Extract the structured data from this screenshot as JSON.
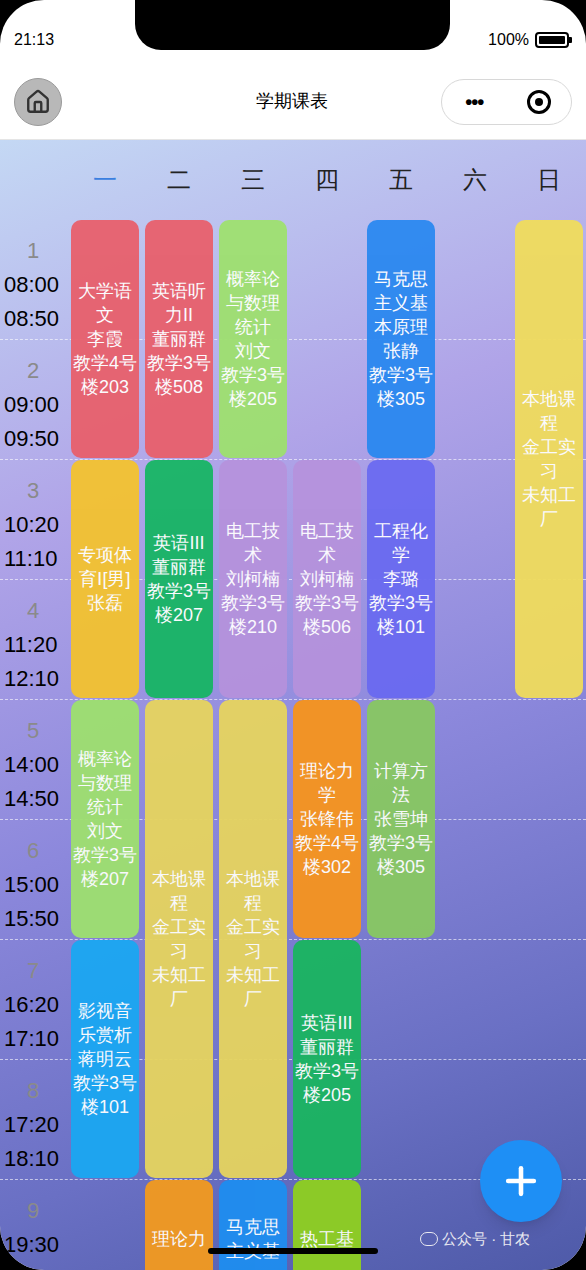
{
  "status_bar": {
    "time": "21:13",
    "battery": "100%",
    "battery_level": 1
  },
  "nav": {
    "title": "学期课表",
    "menu": "•••"
  },
  "weekdays": [
    {
      "label": "一",
      "selected": true
    },
    {
      "label": "二",
      "selected": false
    },
    {
      "label": "三",
      "selected": false
    },
    {
      "label": "四",
      "selected": false
    },
    {
      "label": "五",
      "selected": false
    },
    {
      "label": "六",
      "selected": false
    },
    {
      "label": "日",
      "selected": false
    }
  ],
  "periods": [
    {
      "number": "1",
      "start": "08:00",
      "end": "08:50"
    },
    {
      "number": "2",
      "start": "09:00",
      "end": "09:50"
    },
    {
      "number": "3",
      "start": "10:20",
      "end": "11:10"
    },
    {
      "number": "4",
      "start": "11:20",
      "end": "12:10"
    },
    {
      "number": "5",
      "start": "14:00",
      "end": "14:50"
    },
    {
      "number": "6",
      "start": "15:00",
      "end": "15:50"
    },
    {
      "number": "7",
      "start": "16:20",
      "end": "17:10"
    },
    {
      "number": "8",
      "start": "17:20",
      "end": "18:10"
    },
    {
      "number": "9",
      "start": "19:30",
      "end": ""
    }
  ],
  "courses": [
    {
      "name": "大学语文",
      "teacher": "李霞",
      "room": "教学4号楼203",
      "day": 1,
      "start": 1,
      "span": 2,
      "color": "#e8606c"
    },
    {
      "name": "专项体育Ⅰ[男]",
      "teacher": "张磊",
      "room": "",
      "day": 1,
      "start": 3,
      "span": 2,
      "color": "#f3c22f"
    },
    {
      "name": "概率论与数理统计",
      "teacher": "刘文",
      "room": "教学3号楼207",
      "day": 1,
      "start": 5,
      "span": 2,
      "color": "#9ee06f"
    },
    {
      "name": "影视音乐赏析",
      "teacher": "蒋明云",
      "room": "教学3号楼101",
      "day": 1,
      "start": 7,
      "span": 2,
      "color": "#1aa7f2"
    },
    {
      "name": "英语听力II",
      "teacher": "董丽群",
      "room": "教学3号楼508",
      "day": 2,
      "start": 1,
      "span": 2,
      "color": "#e8606c"
    },
    {
      "name": "英语III",
      "teacher": "董丽群",
      "room": "教学3号楼207",
      "day": 2,
      "start": 3,
      "span": 2,
      "color": "#17b564"
    },
    {
      "name": "本地课程",
      "teacher": "金工实习",
      "room": "未知工厂",
      "day": 2,
      "start": 5,
      "span": 4,
      "color": "#e6d45e"
    },
    {
      "name": "理论力",
      "teacher": "",
      "room": "",
      "day": 2,
      "start": 9,
      "span": 1,
      "color": "#f39a1e"
    },
    {
      "name": "概率论与数理统计",
      "teacher": "刘文",
      "room": "教学3号楼205",
      "day": 3,
      "start": 1,
      "span": 2,
      "color": "#9ee06f"
    },
    {
      "name": "电工技术",
      "teacher": "刘柯楠",
      "room": "教学3号楼210",
      "day": 3,
      "start": 3,
      "span": 2,
      "color": "#b592dc"
    },
    {
      "name": "本地课程",
      "teacher": "金工实习",
      "room": "未知工厂",
      "day": 3,
      "start": 5,
      "span": 4,
      "color": "#e6d45e"
    },
    {
      "name": "马克思主义基",
      "teacher": "",
      "room": "",
      "day": 3,
      "start": 9,
      "span": 1,
      "color": "#1e8ef0"
    },
    {
      "name": "电工技术",
      "teacher": "刘柯楠",
      "room": "教学3号楼506",
      "day": 4,
      "start": 3,
      "span": 2,
      "color": "#b592dc"
    },
    {
      "name": "理论力学",
      "teacher": "张锋伟",
      "room": "教学4号楼302",
      "day": 4,
      "start": 5,
      "span": 2,
      "color": "#f7941d"
    },
    {
      "name": "英语III",
      "teacher": "董丽群",
      "room": "教学3号楼205",
      "day": 4,
      "start": 7,
      "span": 2,
      "color": "#1ab560"
    },
    {
      "name": "热工基",
      "teacher": "",
      "room": "",
      "day": 4,
      "start": 9,
      "span": 1,
      "color": "#8fd020"
    },
    {
      "name": "马克思主义基本原理",
      "teacher": "张静",
      "room": "教学3号楼305",
      "day": 5,
      "start": 1,
      "span": 2,
      "color": "#2a88f0"
    },
    {
      "name": "工程化学",
      "teacher": "李璐",
      "room": "教学3号楼101",
      "day": 5,
      "start": 3,
      "span": 2,
      "color": "#6a6af0"
    },
    {
      "name": "计算方法",
      "teacher": "张雪坤",
      "room": "教学3号楼305",
      "day": 5,
      "start": 5,
      "span": 2,
      "color": "#88c862"
    },
    {
      "name": "本地课程",
      "teacher": "金工实习",
      "room": "未知工厂",
      "day": 7,
      "start": 1,
      "span": 4,
      "color": "#f0dc5c"
    }
  ],
  "watermark": "公众号 · 甘农"
}
